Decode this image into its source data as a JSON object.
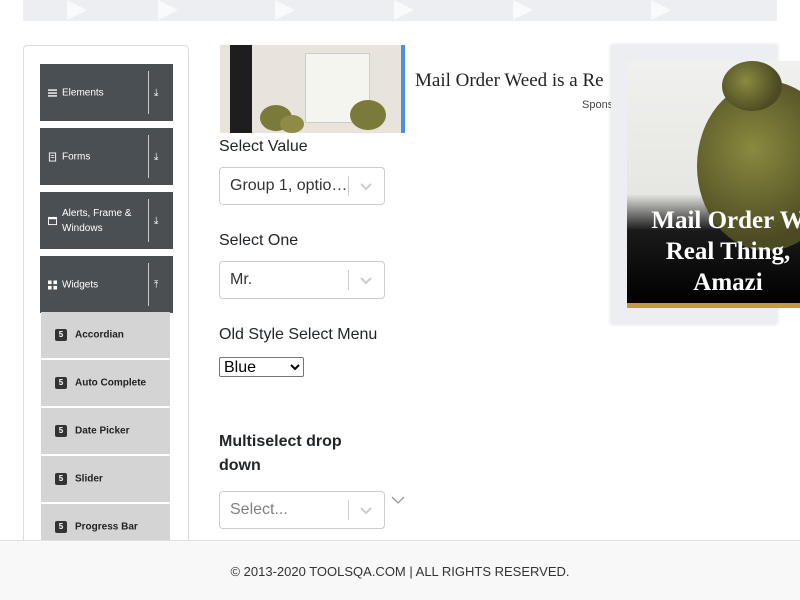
{
  "sidebar": {
    "groups": [
      {
        "label": "Elements",
        "icon": "menu-icon",
        "arrow": "⤓"
      },
      {
        "label": "Forms",
        "icon": "document-icon",
        "arrow": "⤓"
      },
      {
        "label": "Alerts, Frame & Windows",
        "icon": "window-icon",
        "arrow": "⤓"
      },
      {
        "label": "Widgets",
        "icon": "grid-icon",
        "arrow": "⤒"
      }
    ],
    "items": [
      {
        "label": "Accordian",
        "icon": "html5-icon"
      },
      {
        "label": "Auto Complete",
        "icon": "html5-icon"
      },
      {
        "label": "Date Picker",
        "icon": "html5-icon"
      },
      {
        "label": "Slider",
        "icon": "html5-icon"
      },
      {
        "label": "Progress Bar",
        "icon": "html5-icon"
      }
    ]
  },
  "ad": {
    "title": "Mail Order Weed is a Re",
    "sponsored": "Spons",
    "popup_text": "Mail Order W\nReal Thing,\nAmazi",
    "accent": "#4a90e2"
  },
  "form": {
    "select_value": {
      "label": "Select Value",
      "value": "Group 1, optio…"
    },
    "select_one": {
      "label": "Select One",
      "value": "Mr."
    },
    "old_style": {
      "label": "Old Style Select Menu",
      "value": "Blue"
    },
    "multiselect": {
      "label": "Multiselect drop down",
      "placeholder": "Select..."
    }
  },
  "footer": {
    "text": "© 2013-2020 TOOLSQA.COM | ALL RIGHTS RESERVED."
  }
}
